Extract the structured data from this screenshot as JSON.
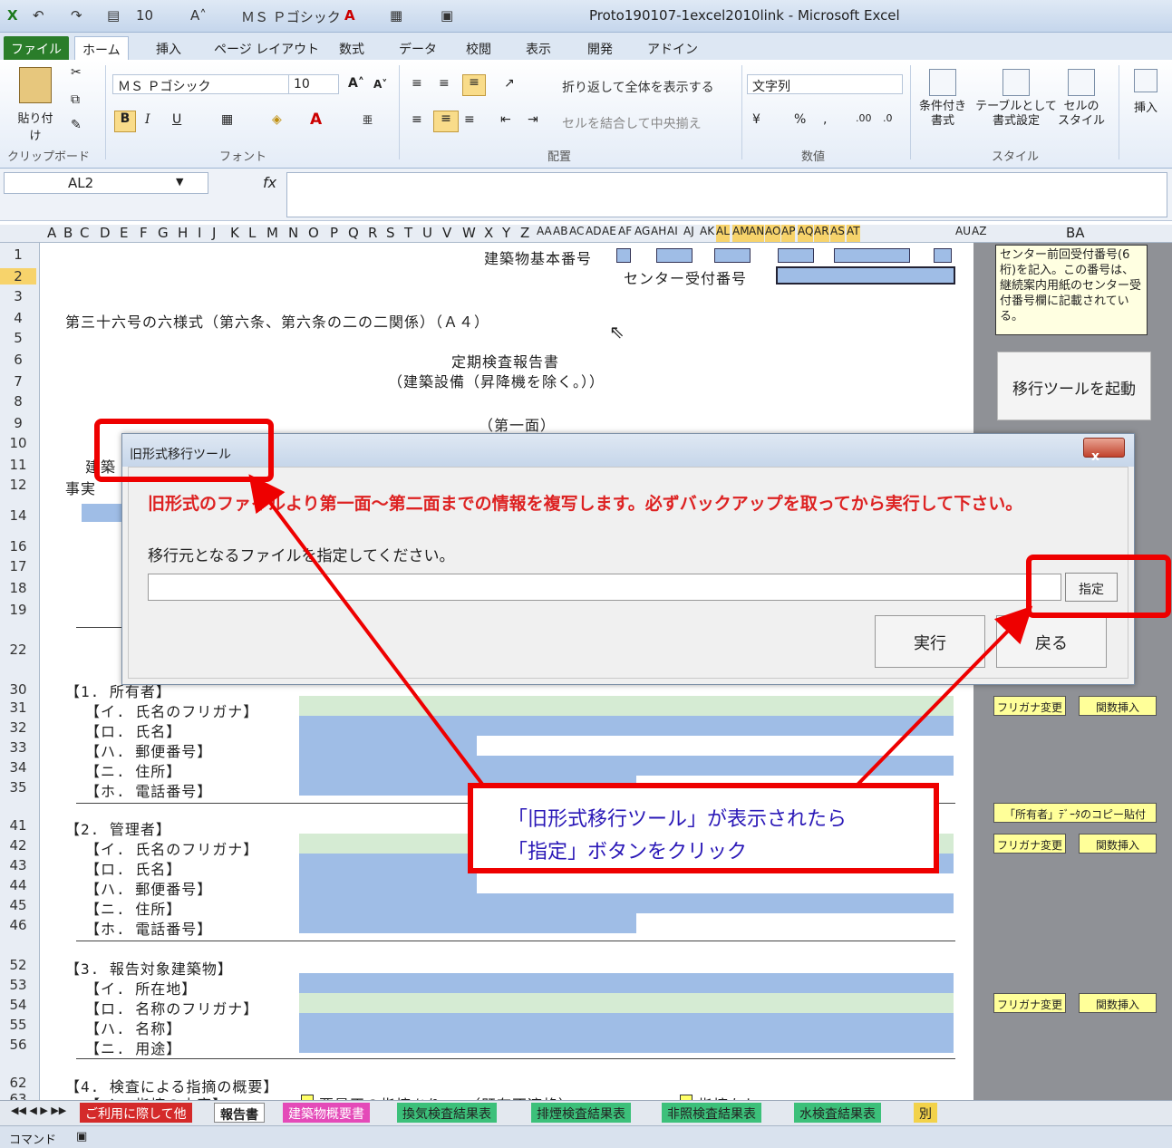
{
  "window": {
    "title": "Proto190107-1excel2010link - Microsoft Excel",
    "qa_font_size": "10",
    "qa_font_name": "ＭＳ Ｐゴシック"
  },
  "tabs": [
    "ファイル",
    "ホーム",
    "挿入",
    "ページ レイアウト",
    "数式",
    "データ",
    "校閲",
    "表示",
    "開発",
    "アドイン"
  ],
  "ribbon": {
    "paste_label": "貼り付け",
    "clipboard_group": "クリップボード",
    "font_name": "ＭＳ Ｐゴシック",
    "font_size": "10",
    "font_group": "フォント",
    "wrap_text": "折り返して全体を表示する",
    "merge_center": "セルを結合して中央揃え",
    "align_group": "配置",
    "number_format": "文字列",
    "number_group": "数値",
    "cond_format": "条件付き\n書式",
    "table_format": "テーブルとして\n書式設定",
    "cell_style": "セルの\nスタイル",
    "styles_group": "スタイル",
    "insert": "挿入"
  },
  "formula_bar": {
    "name_box": "AL2",
    "fx": "fx"
  },
  "columns": [
    "A",
    "B",
    "C",
    "D",
    "E",
    "F",
    "G",
    "H",
    "I",
    "J",
    "K",
    "L",
    "M",
    "N",
    "O",
    "P",
    "Q",
    "R",
    "S",
    "T",
    "U",
    "V",
    "W",
    "X",
    "Y",
    "Z",
    "AA",
    "AB",
    "AC",
    "AD",
    "AE",
    "AF",
    "AG",
    "AH",
    "AI",
    "AJ",
    "AK",
    "AL",
    "AM",
    "AN",
    "AO",
    "AP",
    "AQ",
    "AR",
    "AS",
    "AT",
    "AU",
    "AZ",
    "BA"
  ],
  "rows": [
    "1",
    "2",
    "3",
    "4",
    "5",
    "6",
    "7",
    "8",
    "9",
    "10",
    "11",
    "12",
    "14",
    "16",
    "17",
    "18",
    "19",
    "22",
    "30",
    "31",
    "32",
    "33",
    "34",
    "35",
    "41",
    "42",
    "43",
    "44",
    "45",
    "46",
    "52",
    "53",
    "54",
    "55",
    "56",
    "62",
    "63"
  ],
  "sheet": {
    "bldg_no_label": "建築物基本番号",
    "center_no_label": "センター受付番号",
    "form_title": "第三十六号の六様式（第六条、第六条の二の二関係）（Ａ４）",
    "report_title": "定期検査報告書",
    "report_subtitle": "（建築設備（昇降機を除く。））",
    "page_label": "（第一面）",
    "frag_11": "建築",
    "frag_12": "事実",
    "owner_header": "【1. 所有者】",
    "owner_items": [
      "【イ. 氏名のフリガナ】",
      "【ロ. 氏名】",
      "【ハ. 郵便番号】",
      "【ニ. 住所】",
      "【ホ. 電話番号】"
    ],
    "manager_header": "【2. 管理者】",
    "manager_items": [
      "【イ. 氏名のフリガナ】",
      "【ロ. 氏名】",
      "【ハ. 郵便番号】",
      "【ニ. 住所】",
      "【ホ. 電話番号】"
    ],
    "building_header": "【3. 報告対象建築物】",
    "building_items": [
      "【イ. 所在地】",
      "【ロ. 名称のフリガナ】",
      "【ハ. 名称】",
      "【ニ. 用途】"
    ],
    "inspection_header": "【4. 検査による指摘の概要】",
    "inspection_row": "【イ. 指摘の内容】",
    "inspection_options": [
      "要是正の指摘あり",
      "（既存不適格）",
      "指摘なし"
    ]
  },
  "right_pane": {
    "note": "センター前回受付番号(6桁)を記入。この番号は、継続案内用紙のセンター受付番号欄に記載されている。",
    "launch_button": "移行ツールを起動",
    "furigana_change": "フリガナ変更",
    "func_insert": "関数挿入",
    "copy_owner": "「所有者」ﾃﾞｰﾀのコピー貼付"
  },
  "dialog": {
    "title": "旧形式移行ツール",
    "close": "x",
    "warning": "旧形式のファイルより第一面～第二面までの情報を複写します。必ずバックアップを取ってから実行して下さい。",
    "prompt": "移行元となるファイルを指定してください。",
    "input_value": "",
    "specify_button": "指定",
    "run_button": "実行",
    "back_button": "戻る"
  },
  "annotation": {
    "line1": "「旧形式移行ツール」が表示されたら",
    "line2": "「指定」ボタンをクリック"
  },
  "sheet_tabs": [
    "ご利用に際して他",
    "報告書",
    "建築物概要書",
    "換気検査結果表",
    "排煙検査結果表",
    "非照検査結果表",
    "水検査結果表",
    "別"
  ],
  "status": {
    "mode": "コマンド"
  },
  "colors": {
    "accent_red": "#ee0000",
    "band_blue": "#9fbde6",
    "band_green": "#d5ebd3",
    "pane_gray": "#8f9196"
  }
}
